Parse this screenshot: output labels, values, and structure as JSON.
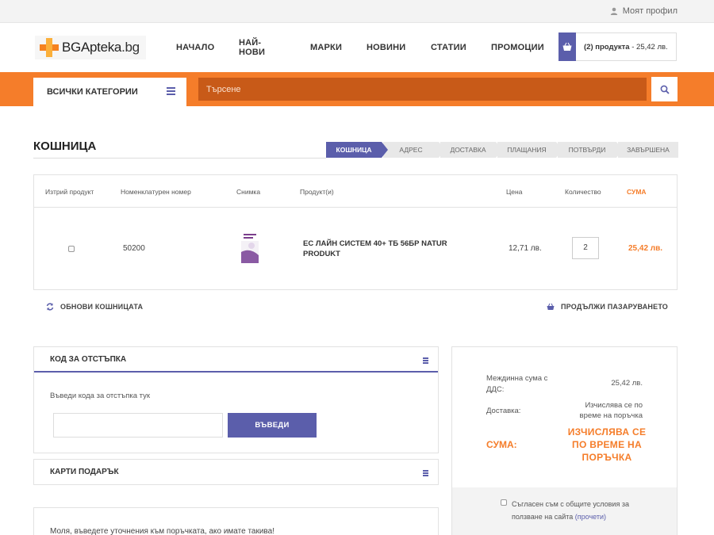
{
  "topbar": {
    "profile_label": "Моят профил"
  },
  "header": {
    "logo_text_main": "BGApteka",
    "logo_text_tld": ".bg",
    "nav": [
      "НАЧАЛО",
      "НАЙ-НОВИ",
      "МАРКИ",
      "НОВИНИ",
      "СТАТИИ",
      "ПРОМОЦИИ"
    ],
    "cart_count": "(2) продукта",
    "cart_total": " - 25,42 лв."
  },
  "searchbar": {
    "categories_label": "ВСИЧКИ КАТЕГОРИИ",
    "search_placeholder": "Търсене"
  },
  "page": {
    "title": "КОШНИЦА",
    "steps": [
      "КОШНИЦА",
      "АДРЕС",
      "ДОСТАВКА",
      "ПЛАЩАНИЯ",
      "ПОТВЪРДИ",
      "ЗАВЪРШЕНА"
    ],
    "active_step": 0
  },
  "cart_table": {
    "headers": {
      "remove": "Изтрий продукт",
      "sku": "Номенклатурен номер",
      "image": "Снимка",
      "product": "Продукт(и)",
      "price": "Цена",
      "quantity": "Количество",
      "sum": "СУМА"
    },
    "rows": [
      {
        "sku": "50200",
        "name": "ЕС ЛАЙН СИСТЕМ 40+ ТБ 56БР NATUR PRODUKT",
        "price": "12,71 лв.",
        "quantity": "2",
        "sum": "25,42 лв."
      }
    ]
  },
  "actions": {
    "update_cart": "ОБНОВИ КОШНИЦАТА",
    "continue_shopping": "ПРОДЪЛЖИ ПАЗАРУВАНЕТО"
  },
  "discount": {
    "title": "КОД ЗА ОТСТЪПКА",
    "label": "Въведи кода за отстъпка тук",
    "button": "ВЪВЕДИ"
  },
  "gift_cards": {
    "title": "КАРТИ ПОДАРЪК"
  },
  "order_note": {
    "text": "Моля, въведете уточнения към поръчката, ако имате такива!"
  },
  "summary": {
    "subtotal_label": "Междинна сума с ДДС:",
    "subtotal_value": "25,42 лв.",
    "shipping_label": "Доставка:",
    "shipping_value": "Изчислява се по време на поръчка",
    "total_label": "СУМА:",
    "total_value": "ИЗЧИСЛЯВА СЕ ПО ВРЕМЕ НА ПОРЪЧКА",
    "terms_text": "Съгласен съм с общите условия за ползване на сайта",
    "terms_link": "(прочети)"
  },
  "colors": {
    "accent": "#5b5eab",
    "orange": "#f57d2a",
    "search_bg": "#c85a18"
  },
  "icons": [
    "user-icon",
    "basket-icon",
    "menu-icon",
    "search-icon",
    "refresh-icon"
  ]
}
